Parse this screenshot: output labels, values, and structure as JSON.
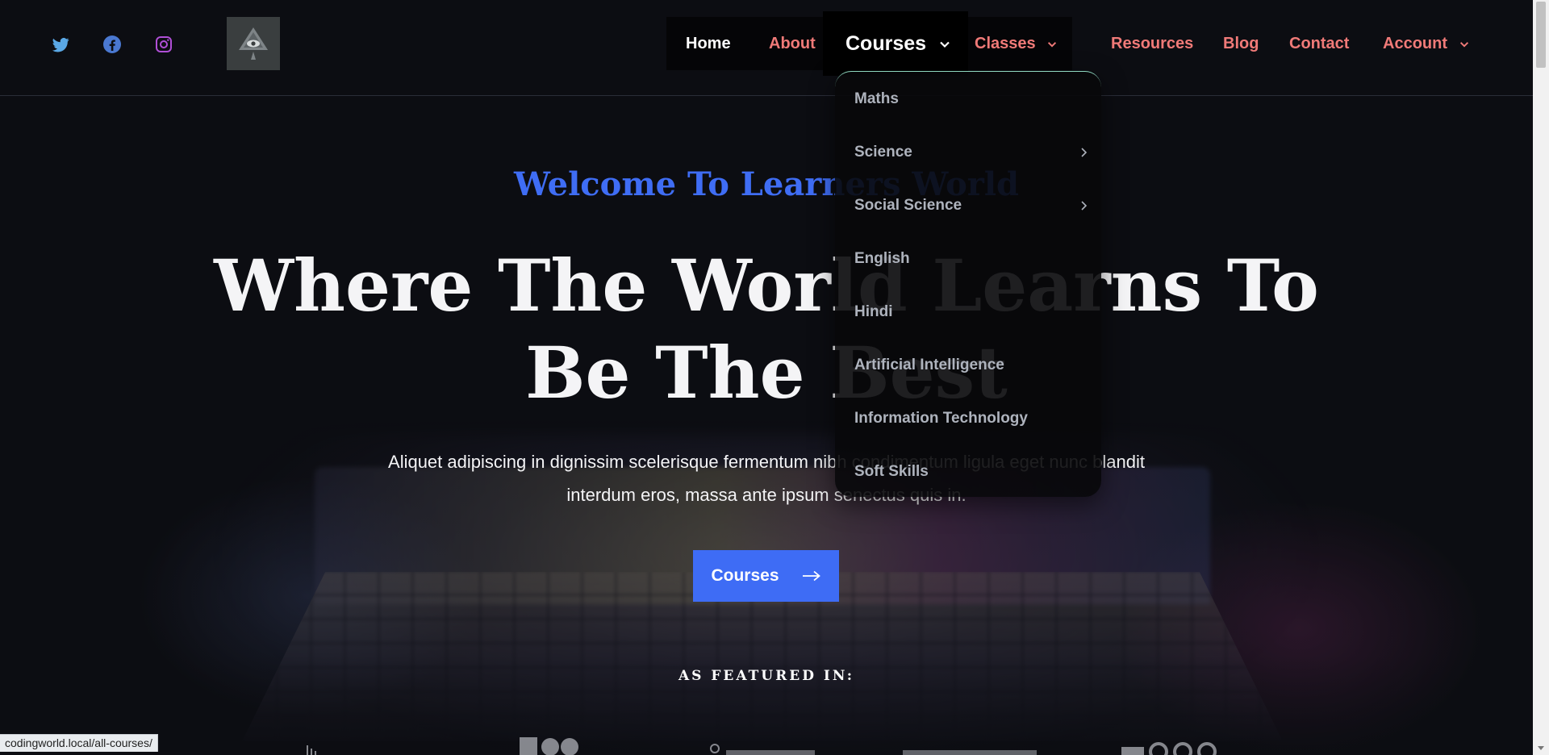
{
  "header": {
    "social": [
      "twitter-icon",
      "facebook-icon",
      "instagram-icon"
    ],
    "nav": {
      "home": "Home",
      "about": "About",
      "courses": "Courses",
      "classes": "Classes",
      "resources": "Resources",
      "blog": "Blog",
      "contact": "Contact",
      "account": "Account"
    }
  },
  "dropdown": {
    "items": [
      {
        "label": "Maths",
        "has_submenu": false
      },
      {
        "label": "Science",
        "has_submenu": true
      },
      {
        "label": "Social Science",
        "has_submenu": true
      },
      {
        "label": "English",
        "has_submenu": false
      },
      {
        "label": "Hindi",
        "has_submenu": false
      },
      {
        "label": "Artificial Intelligence",
        "has_submenu": false
      },
      {
        "label": "Information Technology",
        "has_submenu": false
      },
      {
        "label": "Soft Skills",
        "has_submenu": false
      }
    ]
  },
  "hero": {
    "welcome": "Welcome To Learners World",
    "headline_line1": "Where The World Learns To",
    "headline_line2": "Be The Best",
    "subtext": "Aliquet adipiscing in dignissim scelerisque fermentum nibh condimentum ligula eget nunc blandit interdum eros, massa ante ipsum senectus quis in.",
    "cta_label": "Courses",
    "featured_label": "AS FEATURED IN:"
  },
  "status_url": "codingworld.local/all-courses/",
  "colors": {
    "accent_blue": "#3e6cf5",
    "nav_link": "#f07a78",
    "background": "#0c0d12",
    "dropdown_border": "#8fd8c0"
  }
}
